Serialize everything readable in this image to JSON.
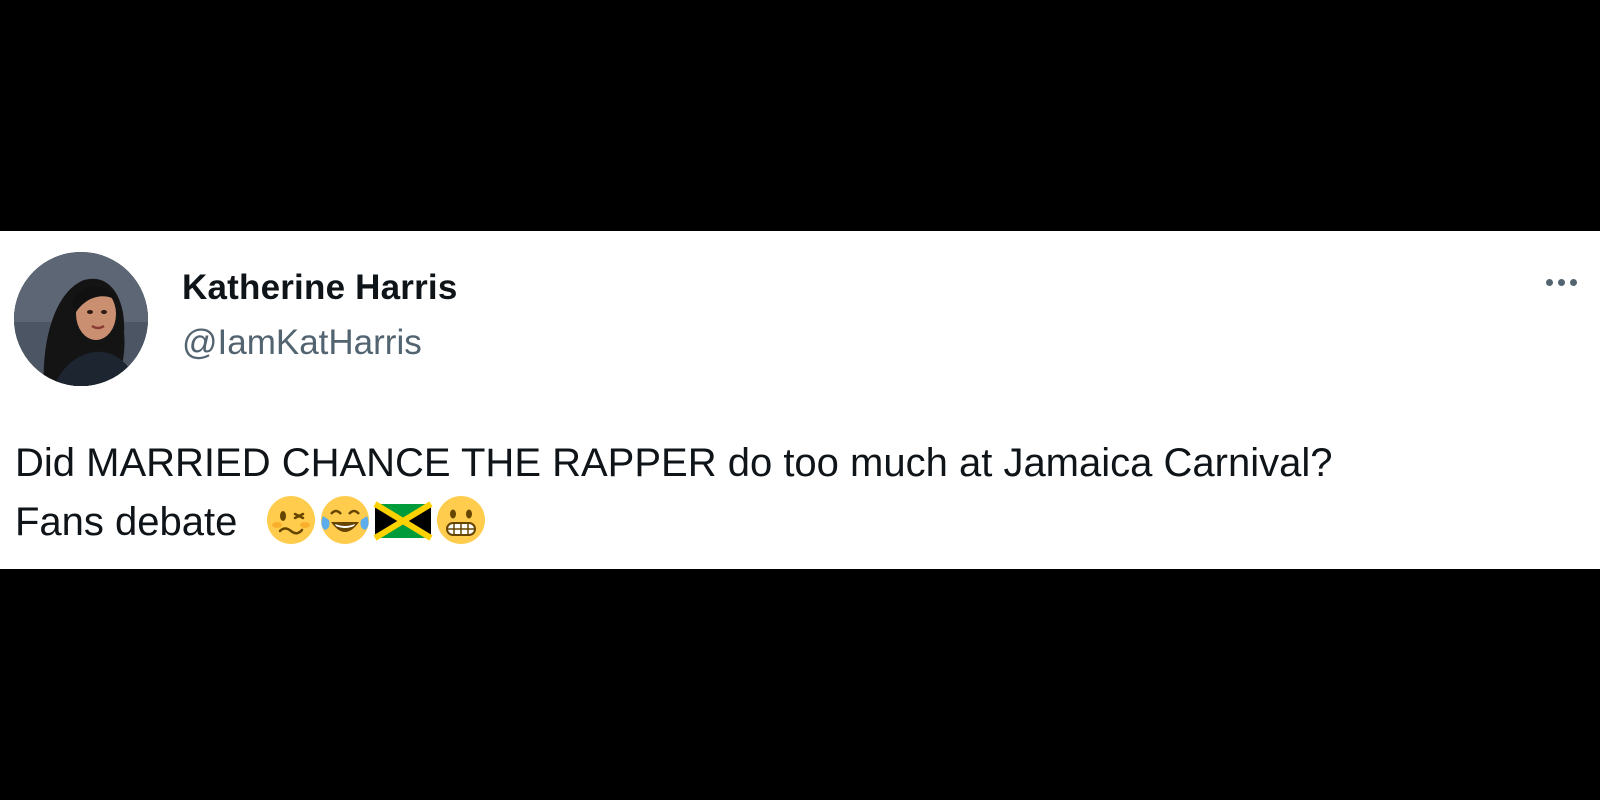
{
  "tweet": {
    "author": {
      "display_name": "Katherine Harris",
      "handle": "@IamKatHarris",
      "avatar_icon": "profile-photo-avatar"
    },
    "more_icon": "more-horizontal-icon",
    "text_line1": "Did MARRIED CHANCE THE RAPPER do too much at Jamaica Carnival?",
    "text_line2": "Fans debate",
    "emojis": [
      "woozy-face-emoji",
      "face-with-tears-of-joy-emoji",
      "jamaica-flag-emoji",
      "grimacing-face-emoji"
    ]
  },
  "colors": {
    "background": "#000000",
    "card": "#ffffff",
    "name_text": "#0f1419",
    "secondary_text": "#536471",
    "emoji_yellow": "#ffcc4d",
    "flag_green": "#009b3a",
    "flag_gold": "#fed100",
    "flag_black": "#000000"
  }
}
